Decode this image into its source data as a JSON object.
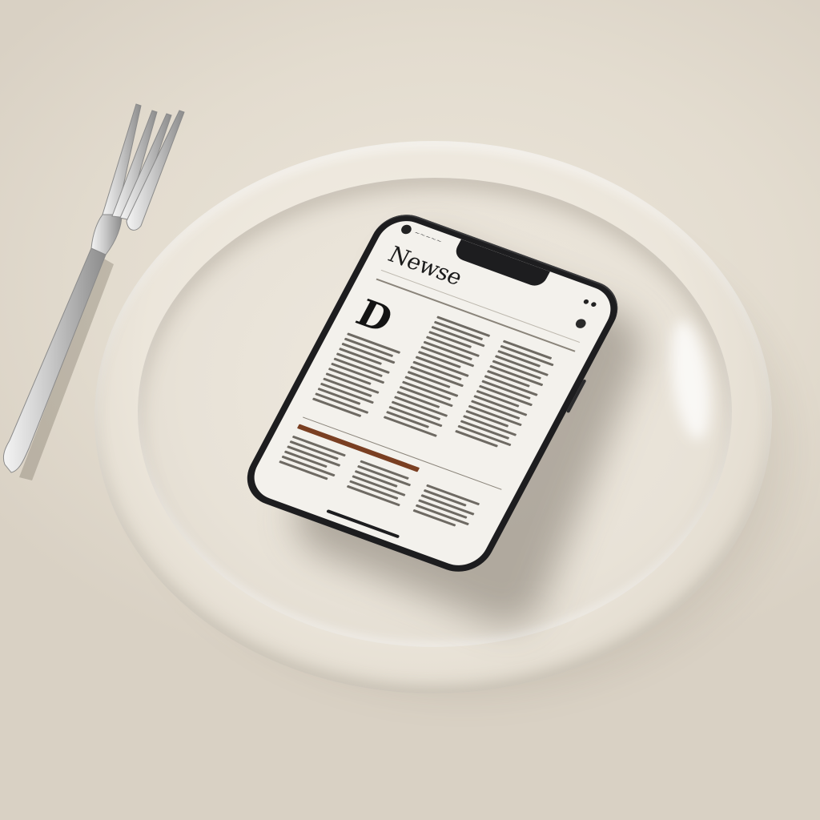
{
  "scene": {
    "description_colors": {
      "tablecloth": "#e6dfd3",
      "plate": "#efe9df",
      "phone_frame": "#1d1d1f",
      "screen": "#f3f1ec"
    }
  },
  "phone": {
    "app_title": "Newse",
    "drop_cap": "D",
    "icons": [
      "camera-icon",
      "settings-icon"
    ]
  },
  "fork": {
    "icon": "fork-icon"
  }
}
